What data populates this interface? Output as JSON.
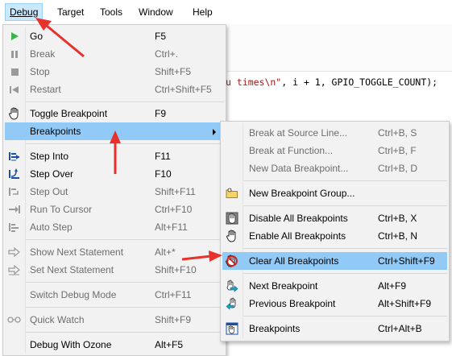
{
  "menubar": {
    "items": [
      {
        "label": "Debug",
        "underline": "D"
      },
      {
        "label": "Target",
        "underline": "T"
      },
      {
        "label": "Tools",
        "underline": "T"
      },
      {
        "label": "Window",
        "underline": "W"
      },
      {
        "label": "Help",
        "underline": "H"
      }
    ]
  },
  "editor": {
    "code_string": "u times\\n\"",
    "code_rest": ", i + 1, GPIO_TOGGLE_COUNT);"
  },
  "debug_menu": {
    "items": [
      {
        "label": "Go",
        "shortcut": "F5",
        "icon": "play-icon",
        "enabled": true
      },
      {
        "label": "Break",
        "shortcut": "Ctrl+.",
        "icon": "pause-icon",
        "enabled": false
      },
      {
        "label": "Stop",
        "shortcut": "Shift+F5",
        "icon": "stop-icon",
        "enabled": false
      },
      {
        "label": "Restart",
        "shortcut": "Ctrl+Shift+F5",
        "icon": "restart-icon",
        "enabled": false
      },
      {
        "label": "Toggle Breakpoint",
        "shortcut": "F9",
        "icon": "hand-icon",
        "enabled": true
      },
      {
        "label": "Breakpoints",
        "shortcut": "",
        "icon": "",
        "enabled": true,
        "highlighted": true,
        "submenu": true
      },
      {
        "label": "Step Into",
        "shortcut": "F11",
        "icon": "step-into-icon",
        "enabled": true
      },
      {
        "label": "Step Over",
        "shortcut": "F10",
        "icon": "step-over-icon",
        "enabled": true
      },
      {
        "label": "Step Out",
        "shortcut": "Shift+F11",
        "icon": "step-out-icon",
        "enabled": false
      },
      {
        "label": "Run To Cursor",
        "shortcut": "Ctrl+F10",
        "icon": "run-to-cursor-icon",
        "enabled": false
      },
      {
        "label": "Auto Step",
        "shortcut": "Alt+F11",
        "icon": "auto-step-icon",
        "enabled": false
      },
      {
        "label": "Show Next Statement",
        "shortcut": "Alt+*",
        "icon": "show-next-icon",
        "enabled": false
      },
      {
        "label": "Set Next Statement",
        "shortcut": "Shift+F10",
        "icon": "set-next-icon",
        "enabled": false
      },
      {
        "label": "Switch Debug Mode",
        "shortcut": "Ctrl+F11",
        "icon": "",
        "enabled": false
      },
      {
        "label": "Quick Watch",
        "shortcut": "Shift+F9",
        "icon": "glasses-icon",
        "enabled": false
      },
      {
        "label": "Debug With Ozone",
        "shortcut": "Alt+F5",
        "icon": "",
        "enabled": true
      }
    ]
  },
  "breakpoints_submenu": {
    "items": [
      {
        "label": "Break at Source Line...",
        "shortcut": "Ctrl+B, S",
        "enabled": false
      },
      {
        "label": "Break at Function...",
        "shortcut": "Ctrl+B, F",
        "enabled": false
      },
      {
        "label": "New Data Breakpoint...",
        "shortcut": "Ctrl+B, D",
        "enabled": false
      },
      {
        "label": "New Breakpoint Group...",
        "shortcut": "",
        "icon": "folder-icon",
        "enabled": true
      },
      {
        "label": "Disable All Breakpoints",
        "shortcut": "Ctrl+B, X",
        "icon": "disable-all-icon",
        "enabled": true
      },
      {
        "label": "Enable All Breakpoints",
        "shortcut": "Ctrl+B, N",
        "icon": "enable-all-icon",
        "enabled": true
      },
      {
        "label": "Clear All Breakpoints",
        "shortcut": "Ctrl+Shift+F9",
        "icon": "clear-all-icon",
        "enabled": true,
        "highlighted": true
      },
      {
        "label": "Next Breakpoint",
        "shortcut": "Alt+F9",
        "icon": "next-bp-icon",
        "enabled": true
      },
      {
        "label": "Previous Breakpoint",
        "shortcut": "Alt+Shift+F9",
        "icon": "prev-bp-icon",
        "enabled": true
      },
      {
        "label": "Breakpoints",
        "shortcut": "Ctrl+Alt+B",
        "icon": "breakpoints-window-icon",
        "enabled": true
      }
    ]
  },
  "colors": {
    "highlight": "#91c9f7",
    "annotation_arrow": "#e8302c",
    "menu_bg": "#f2f2f2",
    "disabled_text": "#6d6d6d"
  }
}
